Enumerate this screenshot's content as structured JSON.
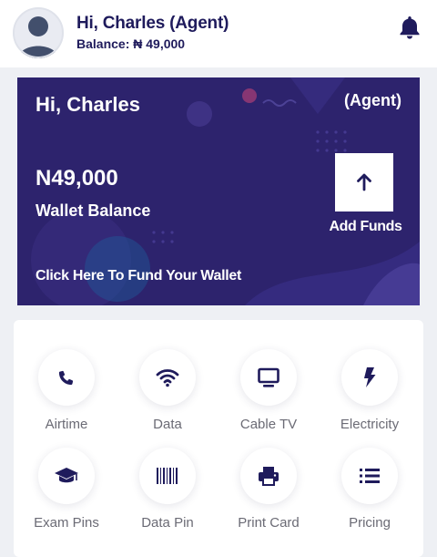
{
  "header": {
    "greeting": "Hi, Charles (Agent)",
    "balance": "Balance: ₦ 49,000"
  },
  "wallet": {
    "greeting": "Hi, Charles",
    "role": "(Agent)",
    "amount": "N49,000",
    "label": "Wallet Balance",
    "add_funds_label": "Add Funds",
    "cta": "Click Here To Fund Your Wallet",
    "background_color": "#2d236d"
  },
  "services": [
    {
      "label": "Airtime",
      "icon": "phone-icon"
    },
    {
      "label": "Data",
      "icon": "wifi-icon"
    },
    {
      "label": "Cable TV",
      "icon": "tv-icon"
    },
    {
      "label": "Electricity",
      "icon": "bolt-icon"
    },
    {
      "label": "Exam Pins",
      "icon": "graduation-cap-icon"
    },
    {
      "label": "Data Pin",
      "icon": "barcode-icon"
    },
    {
      "label": "Print Card",
      "icon": "printer-icon"
    },
    {
      "label": "Pricing",
      "icon": "list-icon"
    }
  ],
  "colors": {
    "brand": "#1f1b5c",
    "card": "#2d236d",
    "label": "#6b6b75"
  }
}
